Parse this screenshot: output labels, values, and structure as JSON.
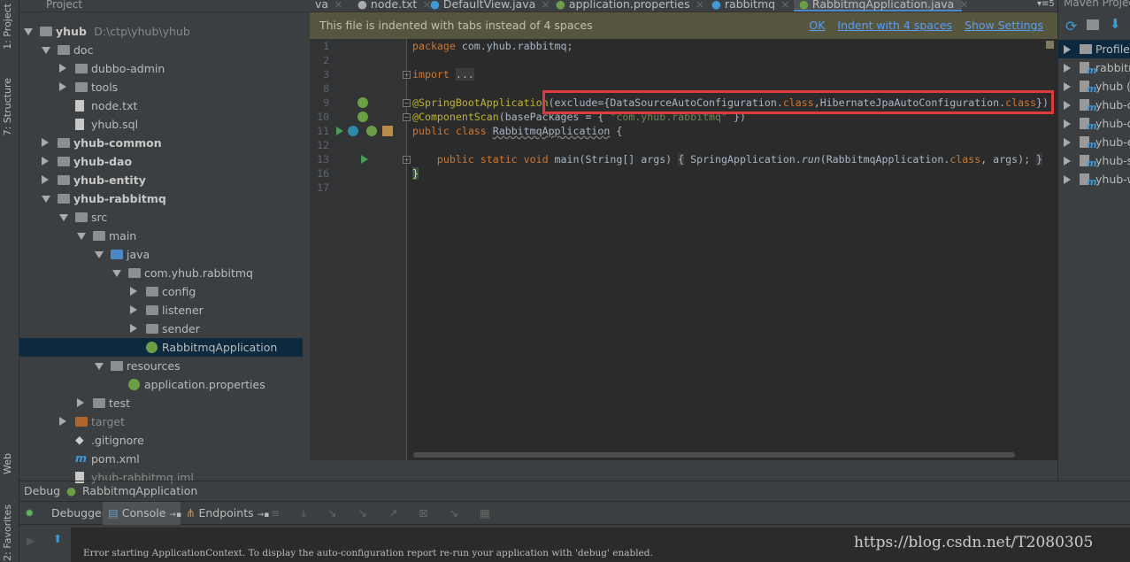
{
  "left_strip": {
    "project": "1: Project",
    "structure": "7: Structure",
    "web": "Web",
    "favorites": "2: Favorites"
  },
  "project": {
    "header": "Project",
    "tree": [
      {
        "level": 0,
        "name": "yhub",
        "path": "D:\\ctp\\yhub\\yhub",
        "state": "open",
        "icon": "module-folder-icon",
        "style": "bold"
      },
      {
        "level": 1,
        "name": "doc",
        "state": "open",
        "icon": "folder-icon"
      },
      {
        "level": 2,
        "name": "dubbo-admin",
        "state": "closed",
        "icon": "folder-icon"
      },
      {
        "level": 2,
        "name": "tools",
        "state": "closed",
        "icon": "folder-icon"
      },
      {
        "level": 2,
        "name": "node.txt",
        "icon": "text-file-icon"
      },
      {
        "level": 2,
        "name": "yhub.sql",
        "icon": "sql-file-icon"
      },
      {
        "level": 1,
        "name": "yhub-common",
        "state": "closed",
        "icon": "module-folder-icon",
        "style": "bold"
      },
      {
        "level": 1,
        "name": "yhub-dao",
        "state": "closed",
        "icon": "module-folder-icon",
        "style": "bold"
      },
      {
        "level": 1,
        "name": "yhub-entity",
        "state": "closed",
        "icon": "module-folder-icon",
        "style": "bold"
      },
      {
        "level": 1,
        "name": "yhub-rabbitmq",
        "state": "open",
        "icon": "module-folder-icon",
        "style": "bold"
      },
      {
        "level": 2,
        "name": "src",
        "state": "open",
        "icon": "folder-icon"
      },
      {
        "level": 3,
        "name": "main",
        "state": "open",
        "icon": "folder-icon"
      },
      {
        "level": 4,
        "name": "java",
        "state": "open",
        "icon": "source-folder-icon",
        "color": "blue"
      },
      {
        "level": 5,
        "name": "com.yhub.rabbitmq",
        "state": "open",
        "icon": "package-icon"
      },
      {
        "level": 6,
        "name": "config",
        "state": "closed",
        "icon": "package-icon"
      },
      {
        "level": 6,
        "name": "listener",
        "state": "closed",
        "icon": "package-icon"
      },
      {
        "level": 6,
        "name": "sender",
        "state": "closed",
        "icon": "package-icon"
      },
      {
        "level": 6,
        "name": "RabbitmqApplication",
        "icon": "spring-boot-class-icon",
        "selected": true
      },
      {
        "level": 4,
        "name": "resources",
        "state": "open",
        "icon": "resources-folder-icon"
      },
      {
        "level": 5,
        "name": "application.properties",
        "icon": "spring-properties-icon"
      },
      {
        "level": 3,
        "name": "test",
        "state": "closed",
        "icon": "folder-icon"
      },
      {
        "level": 2,
        "name": "target",
        "state": "closed",
        "icon": "excluded-folder-icon",
        "color": "orange",
        "style": "grey"
      },
      {
        "level": 2,
        "name": ".gitignore",
        "icon": "git-icon"
      },
      {
        "level": 2,
        "name": "pom.xml",
        "icon": "maven-icon"
      },
      {
        "level": 2,
        "name": "yhub-rabbitmq.iml",
        "icon": "iml-file-icon",
        "style": "grey"
      }
    ]
  },
  "tabs": [
    {
      "label": "va",
      "icon": "",
      "x": 0
    },
    {
      "label": "node.txt",
      "icon": "text-file-icon"
    },
    {
      "label": "DefaultView.java",
      "icon": "class-icon"
    },
    {
      "label": "application.properties",
      "icon": "spring-properties-icon"
    },
    {
      "label": "rabbitmq",
      "icon": "maven-icon"
    },
    {
      "label": "RabbitmqApplication.java",
      "icon": "spring-boot-class-icon",
      "active": true
    }
  ],
  "tabs_overflow": "5",
  "notification": {
    "message": "This file is indented with tabs instead of 4 spaces",
    "ok": "OK",
    "indent": "Indent with 4 spaces",
    "settings": "Show Settings"
  },
  "code": [
    {
      "n": "1",
      "t": [
        [
          "kw",
          "package "
        ],
        [
          "",
          "com.yhub.rabbitmq;"
        ]
      ]
    },
    {
      "n": "2",
      "t": []
    },
    {
      "n": "3",
      "fold": "+",
      "t": [
        [
          "kw",
          "import "
        ],
        [
          "fold",
          "..."
        ]
      ]
    },
    {
      "n": "8",
      "t": []
    },
    {
      "n": "9",
      "fold": "-",
      "t": [
        [
          "an",
          "@SpringBootApplication"
        ],
        [
          "",
          "(exclude={DataSourceAutoConfiguration."
        ],
        [
          "kw",
          "class"
        ],
        [
          "",
          ",HibernateJpaAutoConfiguration."
        ],
        [
          "kw",
          "class"
        ],
        [
          "",
          "})"
        ]
      ]
    },
    {
      "n": "10",
      "fold": "-",
      "t": [
        [
          "an",
          "@ComponentScan"
        ],
        [
          "",
          "(basePackages = { "
        ],
        [
          "st",
          "\"com.yhub.rabbitmq\""
        ],
        [
          "",
          " })"
        ]
      ]
    },
    {
      "n": "11",
      "t": [
        [
          "kw",
          "public class "
        ],
        [
          "wav",
          "RabbitmqApplication"
        ],
        [
          "",
          " {"
        ]
      ]
    },
    {
      "n": "12",
      "t": []
    },
    {
      "n": "13",
      "fold": "+",
      "t": [
        [
          "",
          "    "
        ],
        [
          "kw",
          "public static void "
        ],
        [
          "",
          "main(String[] args) "
        ],
        [
          "fold",
          "{"
        ],
        [
          "",
          " SpringApplication."
        ],
        [
          "it",
          "run"
        ],
        [
          "",
          "(RabbitmqApplication."
        ],
        [
          "kw",
          "class"
        ],
        [
          "",
          ", args); "
        ],
        [
          "fold",
          "}"
        ]
      ]
    },
    {
      "n": "16",
      "t": [
        [
          "",
          "}"
        ]
      ]
    },
    {
      "n": "17",
      "t": []
    }
  ],
  "maven": {
    "header": "Maven Projects",
    "items": [
      "Profiles",
      "rabbitmq",
      "yhub (root)",
      "yhub-common",
      "yhub-dao",
      "yhub-entity",
      "yhub-sender",
      "yhub-web"
    ]
  },
  "debug": {
    "title": "Debug",
    "config": "RabbitmqApplication",
    "tabs": [
      "Debugger",
      "Console",
      "Endpoints"
    ],
    "console_line": "Error starting ApplicationContext. To display the auto-configuration report re-run your application with 'debug' enabled."
  },
  "watermark": "https://blog.csdn.net/T2080305",
  "colors": {
    "keyword": "#cc7832",
    "annotation": "#bbb529",
    "string": "#6a8759",
    "text": "#a9b7c6",
    "highlight_box": "#e0393e",
    "selection": "#0d293e",
    "notification_bg": "#56563f",
    "link": "#589df6"
  }
}
